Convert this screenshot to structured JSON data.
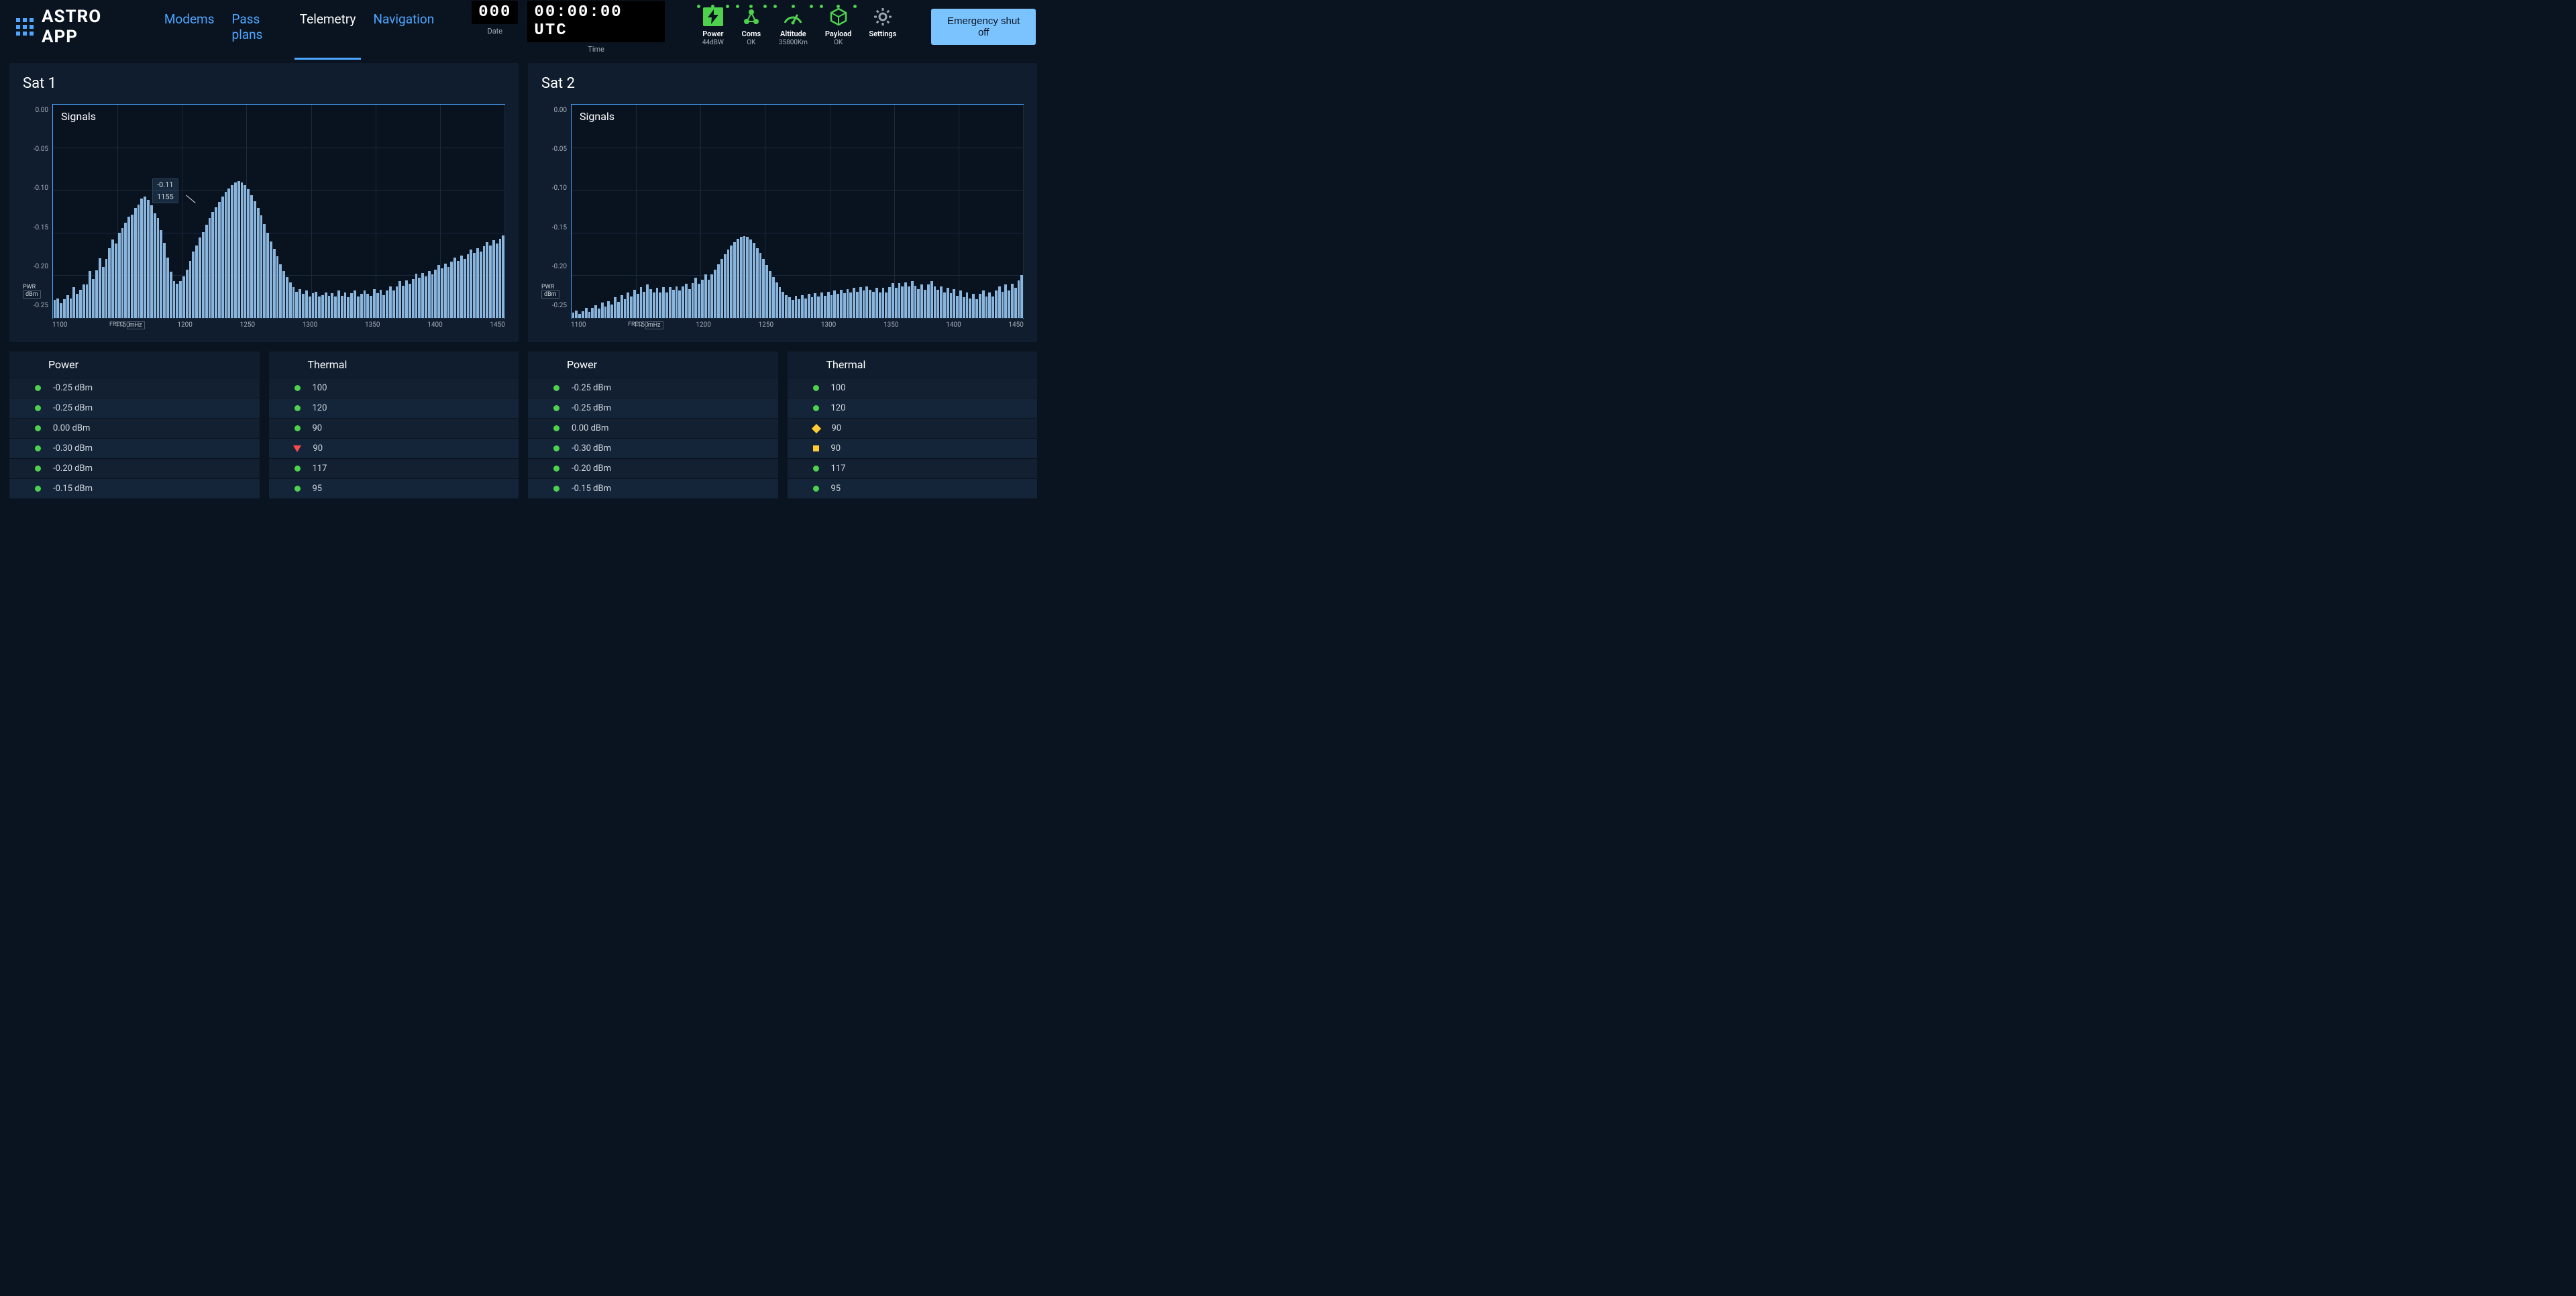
{
  "brand": "ASTRO APP",
  "nav": [
    "Modems",
    "Pass plans",
    "Telemetry",
    "Navigation"
  ],
  "nav_active": 2,
  "clock": {
    "date_value": "000",
    "date_label": "Date",
    "time_value": "00:00:00 UTC",
    "time_label": "Time"
  },
  "monitors": [
    {
      "label": "Power",
      "sub": "44dBW"
    },
    {
      "label": "Coms",
      "sub": "OK"
    },
    {
      "label": "Altitude",
      "sub": "35800Km"
    },
    {
      "label": "Payload",
      "sub": "OK"
    },
    {
      "label": "Settings",
      "sub": ""
    }
  ],
  "emergency_label": "Emergency shut off",
  "sats": [
    {
      "name": "Sat 1",
      "chart_title": "Signals",
      "tooltip": {
        "v1": "-0.11",
        "v2": "1155"
      },
      "power_header": "Power",
      "thermal_header": "Thermal",
      "power_rows": [
        {
          "status": "ok",
          "text": "-0.25 dBm"
        },
        {
          "status": "ok",
          "text": "-0.25 dBm"
        },
        {
          "status": "ok",
          "text": "0.00 dBm"
        },
        {
          "status": "ok",
          "text": "-0.30 dBm"
        },
        {
          "status": "ok",
          "text": "-0.20 dBm"
        },
        {
          "status": "ok",
          "text": "-0.15 dBm"
        }
      ],
      "thermal_rows": [
        {
          "status": "ok",
          "text": "100"
        },
        {
          "status": "ok",
          "text": "120"
        },
        {
          "status": "ok",
          "text": "90"
        },
        {
          "status": "tri",
          "text": "90"
        },
        {
          "status": "ok",
          "text": "117"
        },
        {
          "status": "ok",
          "text": "95"
        }
      ]
    },
    {
      "name": "Sat 2",
      "chart_title": "Signals",
      "tooltip": null,
      "power_header": "Power",
      "thermal_header": "Thermal",
      "power_rows": [
        {
          "status": "ok",
          "text": "-0.25 dBm"
        },
        {
          "status": "ok",
          "text": "-0.25 dBm"
        },
        {
          "status": "ok",
          "text": "0.00 dBm"
        },
        {
          "status": "ok",
          "text": "-0.30 dBm"
        },
        {
          "status": "ok",
          "text": "-0.20 dBm"
        },
        {
          "status": "ok",
          "text": "-0.15 dBm"
        }
      ],
      "thermal_rows": [
        {
          "status": "ok",
          "text": "100"
        },
        {
          "status": "ok",
          "text": "120"
        },
        {
          "status": "diamond",
          "text": "90"
        },
        {
          "status": "square",
          "text": "90"
        },
        {
          "status": "ok",
          "text": "117"
        },
        {
          "status": "ok",
          "text": "95"
        }
      ]
    }
  ],
  "axis": {
    "y_ticks": [
      "0.00",
      "-0.05",
      "-0.10",
      "-0.15",
      "-0.20",
      "-0.25"
    ],
    "y_label": "PWR",
    "y_unit": "dBm",
    "x_ticks": [
      "1100",
      "1150",
      "1200",
      "1250",
      "1300",
      "1350",
      "1400",
      "1450"
    ],
    "x_label": "FREQ",
    "x_unit": "mHz"
  },
  "chart_data": [
    {
      "type": "bar",
      "title": "Sat 1 · Signals",
      "xlabel": "FREQ (mHz)",
      "ylabel": "PWR (dBm)",
      "xlim": [
        1100,
        1450
      ],
      "ylim": [
        -0.25,
        0.0
      ],
      "n_bars": 140,
      "values": [
        -0.229,
        -0.227,
        -0.233,
        -0.228,
        -0.223,
        -0.227,
        -0.214,
        -0.222,
        -0.217,
        -0.211,
        -0.211,
        -0.195,
        -0.204,
        -0.194,
        -0.18,
        -0.19,
        -0.181,
        -0.168,
        -0.158,
        -0.163,
        -0.15,
        -0.145,
        -0.138,
        -0.131,
        -0.129,
        -0.121,
        -0.117,
        -0.11,
        -0.108,
        -0.112,
        -0.118,
        -0.127,
        -0.133,
        -0.147,
        -0.162,
        -0.179,
        -0.196,
        -0.207,
        -0.21,
        -0.207,
        -0.201,
        -0.193,
        -0.183,
        -0.172,
        -0.165,
        -0.156,
        -0.149,
        -0.141,
        -0.133,
        -0.126,
        -0.12,
        -0.114,
        -0.108,
        -0.102,
        -0.098,
        -0.094,
        -0.091,
        -0.09,
        -0.091,
        -0.094,
        -0.099,
        -0.106,
        -0.113,
        -0.121,
        -0.13,
        -0.14,
        -0.15,
        -0.16,
        -0.169,
        -0.178,
        -0.187,
        -0.195,
        -0.202,
        -0.208,
        -0.214,
        -0.219,
        -0.216,
        -0.222,
        -0.218,
        -0.225,
        -0.221,
        -0.219,
        -0.225,
        -0.223,
        -0.22,
        -0.224,
        -0.221,
        -0.225,
        -0.218,
        -0.224,
        -0.22,
        -0.226,
        -0.221,
        -0.218,
        -0.225,
        -0.222,
        -0.218,
        -0.222,
        -0.224,
        -0.216,
        -0.221,
        -0.217,
        -0.223,
        -0.218,
        -0.213,
        -0.218,
        -0.213,
        -0.207,
        -0.212,
        -0.206,
        -0.21,
        -0.204,
        -0.198,
        -0.203,
        -0.197,
        -0.201,
        -0.195,
        -0.199,
        -0.193,
        -0.188,
        -0.192,
        -0.186,
        -0.19,
        -0.184,
        -0.179,
        -0.183,
        -0.177,
        -0.181,
        -0.175,
        -0.17,
        -0.174,
        -0.168,
        -0.172,
        -0.166,
        -0.161,
        -0.165,
        -0.159,
        -0.163,
        -0.157,
        -0.153
      ],
      "tooltip": {
        "x": 1155,
        "y": -0.11
      }
    },
    {
      "type": "bar",
      "title": "Sat 2 · Signals",
      "xlabel": "FREQ (mHz)",
      "ylabel": "PWR (dBm)",
      "xlim": [
        1100,
        1450
      ],
      "ylim": [
        -0.25,
        0.0
      ],
      "n_bars": 140,
      "values": [
        -0.244,
        -0.241,
        -0.245,
        -0.242,
        -0.238,
        -0.243,
        -0.238,
        -0.235,
        -0.239,
        -0.232,
        -0.237,
        -0.23,
        -0.234,
        -0.226,
        -0.231,
        -0.223,
        -0.228,
        -0.22,
        -0.225,
        -0.217,
        -0.222,
        -0.214,
        -0.219,
        -0.211,
        -0.216,
        -0.22,
        -0.215,
        -0.22,
        -0.214,
        -0.22,
        -0.214,
        -0.217,
        -0.213,
        -0.218,
        -0.213,
        -0.21,
        -0.216,
        -0.209,
        -0.203,
        -0.21,
        -0.205,
        -0.199,
        -0.205,
        -0.199,
        -0.193,
        -0.187,
        -0.181,
        -0.175,
        -0.17,
        -0.165,
        -0.161,
        -0.157,
        -0.155,
        -0.154,
        -0.155,
        -0.158,
        -0.162,
        -0.168,
        -0.174,
        -0.181,
        -0.188,
        -0.195,
        -0.202,
        -0.208,
        -0.214,
        -0.219,
        -0.223,
        -0.226,
        -0.229,
        -0.224,
        -0.228,
        -0.223,
        -0.227,
        -0.222,
        -0.226,
        -0.221,
        -0.225,
        -0.22,
        -0.224,
        -0.219,
        -0.223,
        -0.218,
        -0.222,
        -0.217,
        -0.221,
        -0.216,
        -0.22,
        -0.215,
        -0.219,
        -0.214,
        -0.218,
        -0.213,
        -0.217,
        -0.219,
        -0.215,
        -0.22,
        -0.215,
        -0.22,
        -0.214,
        -0.209,
        -0.215,
        -0.209,
        -0.213,
        -0.208,
        -0.213,
        -0.207,
        -0.212,
        -0.216,
        -0.211,
        -0.217,
        -0.211,
        -0.207,
        -0.213,
        -0.217,
        -0.213,
        -0.22,
        -0.215,
        -0.221,
        -0.216,
        -0.224,
        -0.218,
        -0.226,
        -0.22,
        -0.227,
        -0.222,
        -0.228,
        -0.222,
        -0.218,
        -0.225,
        -0.22,
        -0.225,
        -0.218,
        -0.213,
        -0.219,
        -0.211,
        -0.218,
        -0.21,
        -0.215,
        -0.206,
        -0.2
      ]
    }
  ]
}
